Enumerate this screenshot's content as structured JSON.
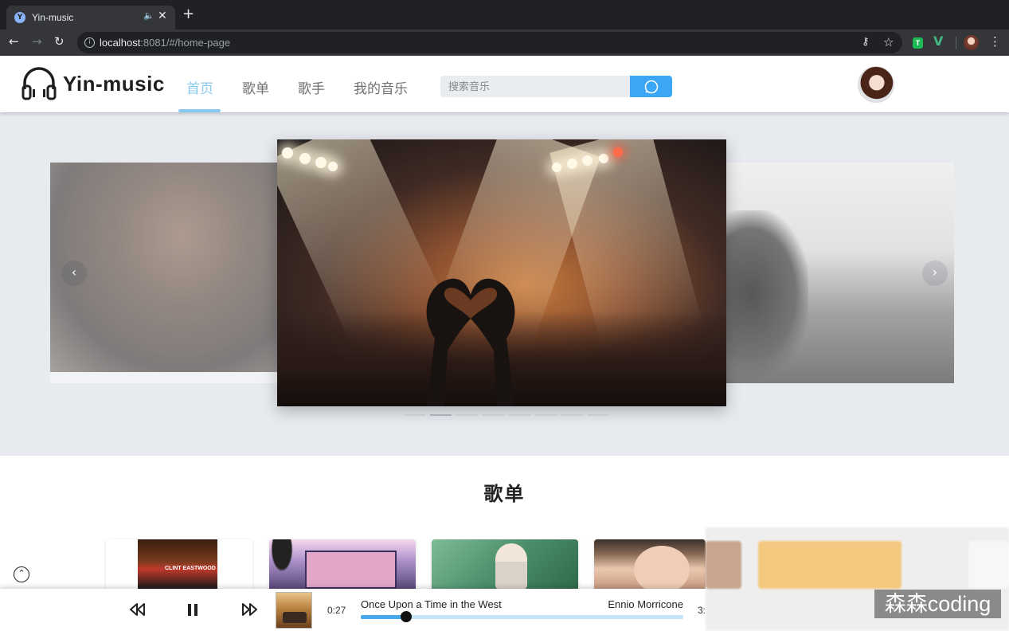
{
  "browser": {
    "tab_title": "Yin-music",
    "favicon_letter": "Y",
    "url_host": "localhost",
    "url_path": ":8081/#/home-page"
  },
  "header": {
    "logo_text": "Yin-music",
    "nav": [
      "首页",
      "歌单",
      "歌手",
      "我的音乐"
    ],
    "active_nav_index": 0,
    "search_placeholder": "搜索音乐",
    "accent_color": "#8ac9ef",
    "search_button_color": "#3aa6f5"
  },
  "carousel": {
    "slide_count": 8,
    "active_index": 1,
    "prev_glyph": "‹",
    "next_glyph": "›"
  },
  "playlists": {
    "section_title": "歌单",
    "covers": [
      {
        "caption": "CLINT EASTWOOD"
      },
      {
        "caption": ""
      },
      {
        "caption": ""
      },
      {
        "caption": ""
      }
    ]
  },
  "player": {
    "current_time": "0:27",
    "total_time_visible": "3:",
    "song_title": "Once Upon a Time in the West",
    "artist": "Ennio Morricone",
    "progress_fraction": 0.14,
    "icons": [
      "rewind-icon",
      "pause-icon",
      "fast-forward-icon"
    ]
  },
  "watermark": "森森coding"
}
